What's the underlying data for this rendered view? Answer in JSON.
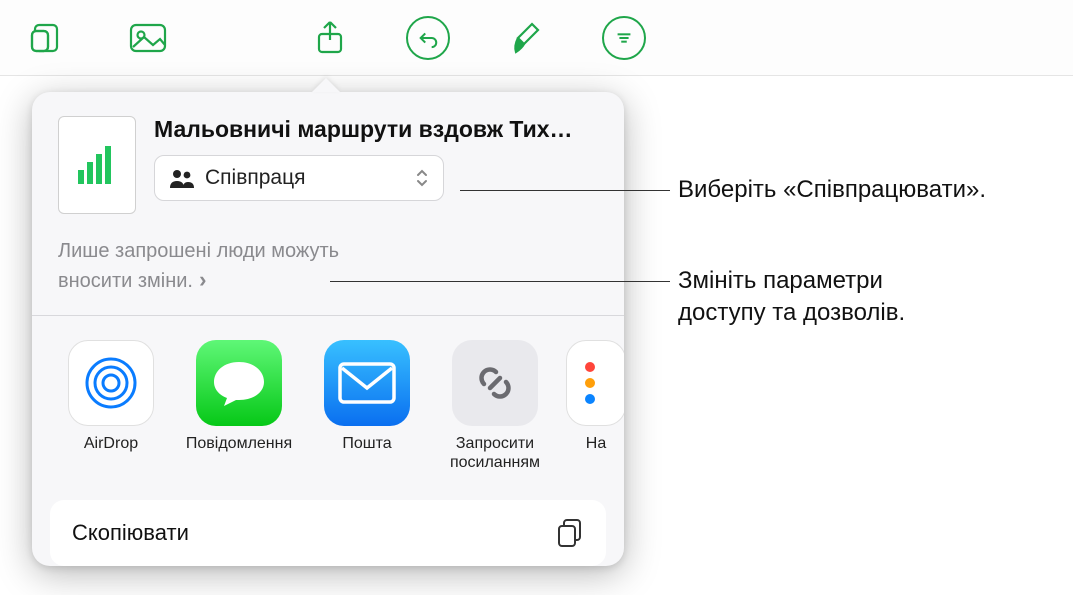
{
  "document": {
    "title": "Мальовничі маршрути вздовж Тих…"
  },
  "collab": {
    "mode": "Співпраця",
    "permission_line1": "Лише запрошені люди можуть",
    "permission_line2": "вносити зміни."
  },
  "share_targets": {
    "airdrop": "AirDrop",
    "messages": "Повідомлення",
    "mail": "Пошта",
    "invite_link": "Запросити посиланням",
    "reminders": "На"
  },
  "actions": {
    "copy": "Скопіювати"
  },
  "callouts": {
    "select_collab": "Виберіть «Співпрацювати».",
    "change_access": "Змініть параметри доступу та дозволів."
  }
}
